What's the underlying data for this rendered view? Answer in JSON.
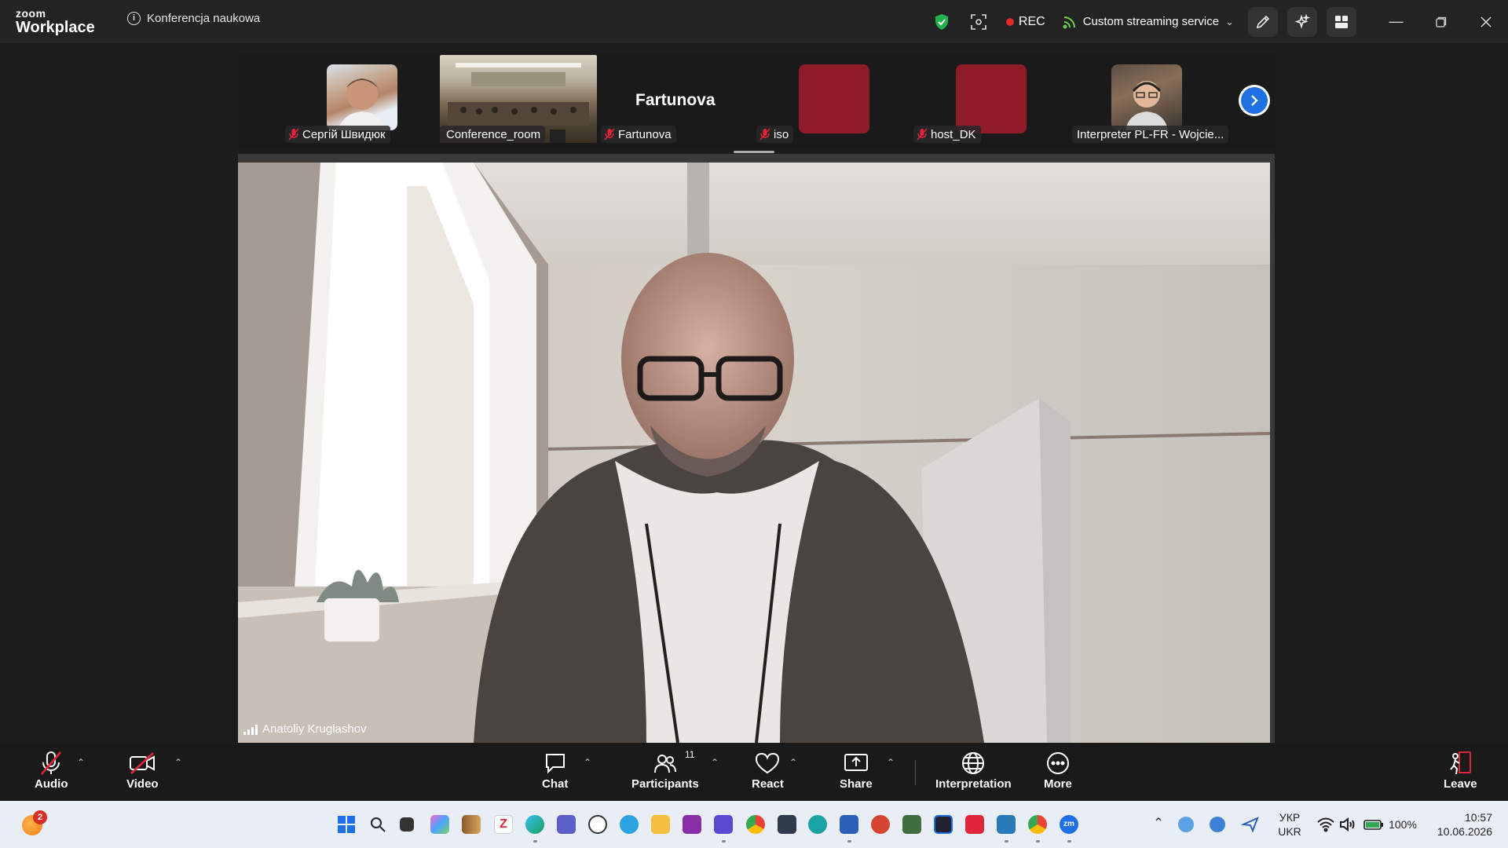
{
  "titlebar": {
    "logo_top": "zoom",
    "logo_bottom": "Workplace",
    "meeting_title": "Konferencja naukowa",
    "rec_label": "REC",
    "streaming_label": "Custom streaming service"
  },
  "participants_strip": [
    {
      "name": "Сергій Швидюк",
      "muted": true,
      "kind": "photo"
    },
    {
      "name": "Conference_room",
      "muted": false,
      "kind": "video"
    },
    {
      "name": "Fartunova",
      "display_name": "Fartunova",
      "muted": true,
      "kind": "name"
    },
    {
      "name": "iso",
      "muted": true,
      "kind": "avatar",
      "color": "#8e1b26"
    },
    {
      "name": "host_DK",
      "muted": true,
      "kind": "avatar",
      "color": "#8e1b26"
    },
    {
      "name": "Interpreter PL-FR - Wojcie...",
      "muted": false,
      "kind": "photo"
    }
  ],
  "main_video": {
    "speaker_name": "Anatoliy Kruglashov"
  },
  "toolbar": {
    "audio": "Audio",
    "video": "Video",
    "chat": "Chat",
    "participants": "Participants",
    "participants_count": "11",
    "react": "React",
    "share": "Share",
    "interpretation": "Interpretation",
    "more": "More",
    "leave": "Leave"
  },
  "taskbar": {
    "notification_count": "2",
    "lang_top": "УКР",
    "lang_bottom": "UKR",
    "battery": "100%",
    "time": "10:57",
    "date": "10.06.2026"
  },
  "colors": {
    "accent_blue": "#1f6fe5",
    "rec_red": "#e02828",
    "shield_green": "#22b24c",
    "avatar_red": "#8e1b26",
    "leave_red": "#e0243a"
  }
}
